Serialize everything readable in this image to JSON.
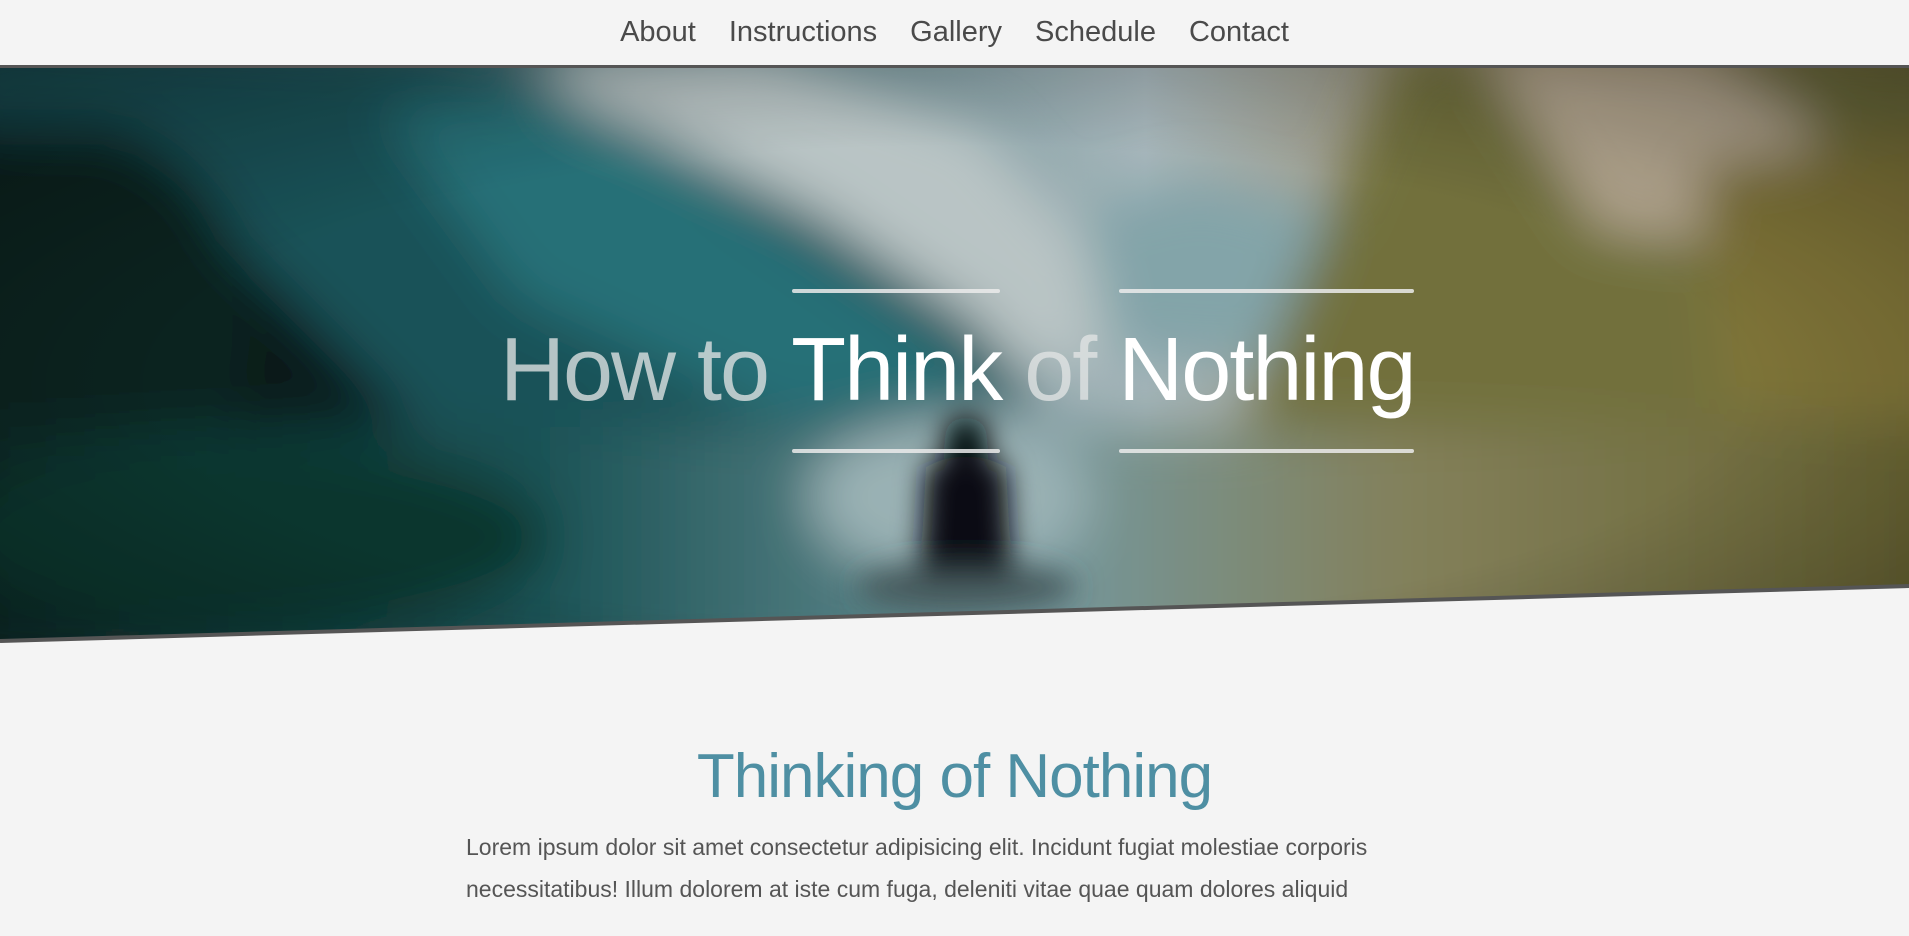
{
  "nav": {
    "items": [
      {
        "label": "About"
      },
      {
        "label": "Instructions"
      },
      {
        "label": "Gallery"
      },
      {
        "label": "Schedule"
      },
      {
        "label": "Contact"
      }
    ]
  },
  "hero": {
    "title_parts": [
      {
        "text": "How to ",
        "style": "dim"
      },
      {
        "text": "Think",
        "style": "bright"
      },
      {
        "text": " of ",
        "style": "dim"
      },
      {
        "text": "Nothing",
        "style": "bright"
      }
    ]
  },
  "content": {
    "heading": "Thinking of Nothing",
    "paragraph": "Lorem ipsum dolor sit amet consectetur adipisicing elit. Incidunt fugiat molestiae corporis necessitatibus! Illum dolorem at iste cum fuga, deleniti vitae quae quam dolores aliquid"
  },
  "colors": {
    "background": "#f4f4f4",
    "nav_text": "#4a4a4a",
    "accent": "#4e8fa3",
    "body_text": "#555555",
    "hero_border": "#555555"
  }
}
